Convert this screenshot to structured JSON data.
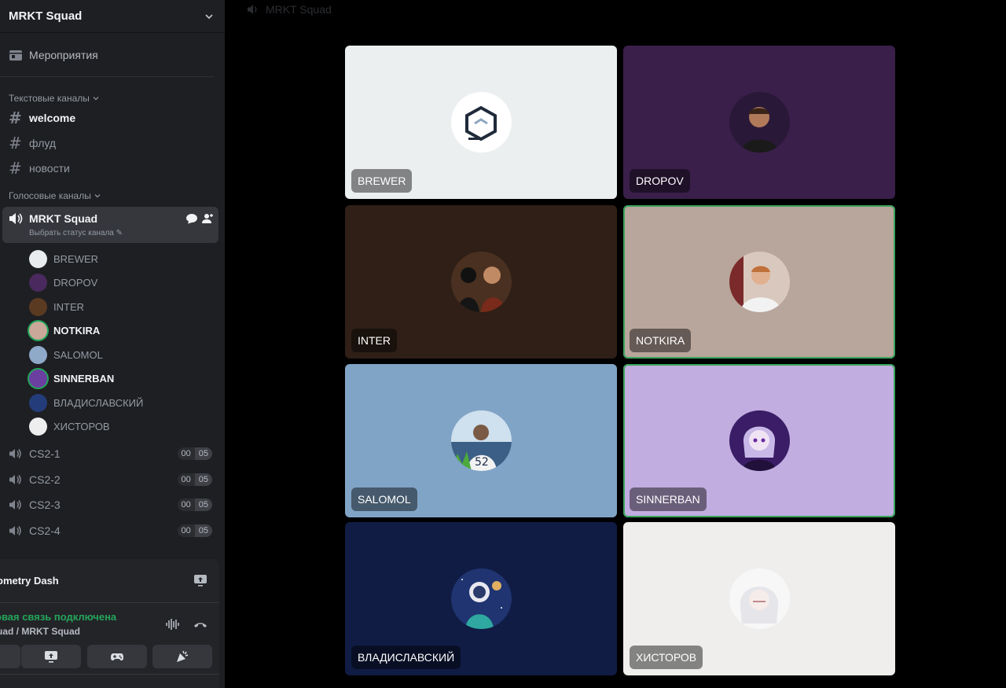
{
  "server": {
    "name": "MRKT Squad"
  },
  "events": {
    "label": "Мероприятия"
  },
  "text_category": {
    "label": "Текстовые каналы"
  },
  "text_channels": [
    {
      "name": "welcome",
      "bold": true
    },
    {
      "name": "флуд",
      "bold": false
    },
    {
      "name": "новости",
      "bold": false
    }
  ],
  "voice_category": {
    "label": "Голосовые каналы"
  },
  "active_voice": {
    "name": "MRKT Squad",
    "status": "Выбрать статус канала"
  },
  "members": [
    {
      "name": "BREWER",
      "color": "#e8ecee",
      "speaking": false
    },
    {
      "name": "DROPOV",
      "color": "#4a2a5e",
      "speaking": false
    },
    {
      "name": "INTER",
      "color": "#5b3a22",
      "speaking": false
    },
    {
      "name": "NOTKIRA",
      "color": "#c9a89a",
      "speaking": true
    },
    {
      "name": "SALOMOL",
      "color": "#8fa9c9",
      "speaking": false
    },
    {
      "name": "SINNERBAN",
      "color": "#6b3fa0",
      "speaking": true
    },
    {
      "name": "ВЛАДИСЛАВСКИЙ",
      "color": "#243d7a",
      "speaking": false
    },
    {
      "name": "ХИСТОРОВ",
      "color": "#eeeeee",
      "speaking": false
    }
  ],
  "voice_channels": [
    {
      "name": "CS2-1",
      "current": "00",
      "max": "05"
    },
    {
      "name": "CS2-2",
      "current": "00",
      "max": "05"
    },
    {
      "name": "CS2-3",
      "current": "00",
      "max": "05"
    },
    {
      "name": "CS2-4",
      "current": "00",
      "max": "05"
    }
  ],
  "panel": {
    "activity": "ometry Dash",
    "connection": "овая связь подключена",
    "location": "uad / MRKT Squad"
  },
  "main": {
    "title": "MRKT Squad"
  },
  "tiles": [
    {
      "name": "BREWER",
      "bg": "#eceff0",
      "avatar_bg": "#ffffff",
      "speaking": false
    },
    {
      "name": "DROPOV",
      "bg": "#3a1f4a",
      "avatar_bg": "#2a1838",
      "speaking": false
    },
    {
      "name": "INTER",
      "bg": "#2f1f16",
      "avatar_bg": "#4a3020",
      "speaking": false
    },
    {
      "name": "NOTKIRA",
      "bg": "#b8a59b",
      "avatar_bg": "#d9c8bd",
      "speaking": true
    },
    {
      "name": "SALOMOL",
      "bg": "#80a4c6",
      "avatar_bg": "#cfe0ee",
      "speaking": false
    },
    {
      "name": "SINNERBAN",
      "bg": "#c1ade0",
      "avatar_bg": "#3a1d66",
      "speaking": true
    },
    {
      "name": "ВЛАДИСЛАВСКИЙ",
      "bg": "#101c44",
      "avatar_bg": "#1f3470",
      "speaking": false
    },
    {
      "name": "ХИСТОРОВ",
      "bg": "#efeeed",
      "avatar_bg": "#f7f7f7",
      "speaking": false
    }
  ]
}
